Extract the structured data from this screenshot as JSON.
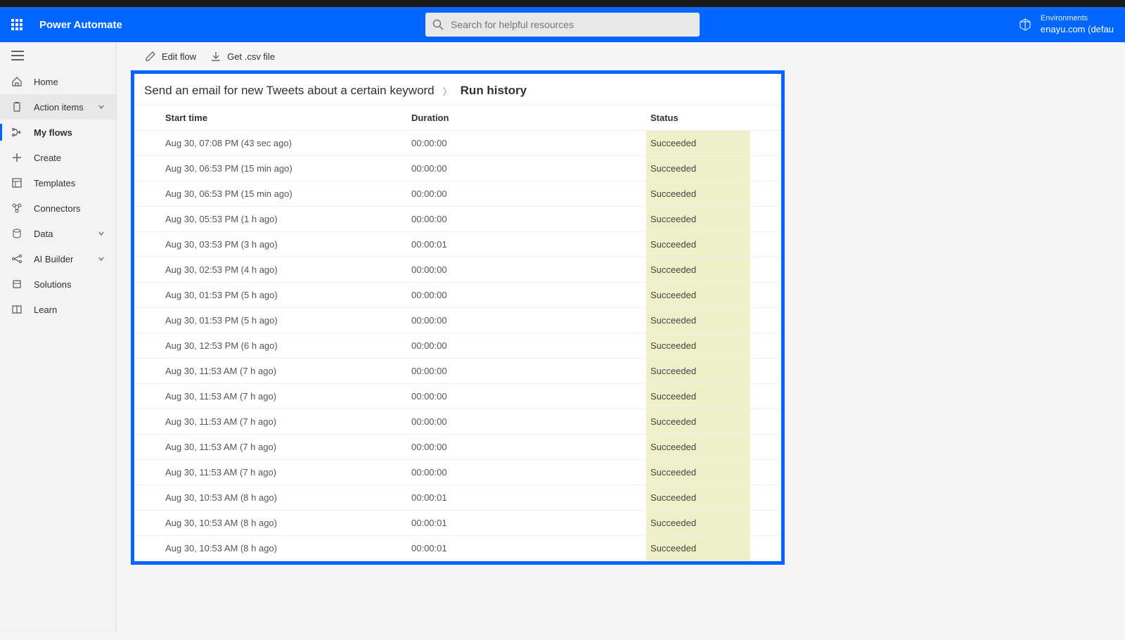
{
  "header": {
    "brand": "Power Automate",
    "search_placeholder": "Search for helpful resources",
    "env_label": "Environments",
    "env_value": "enayu.com (defau"
  },
  "sidebar": {
    "items": [
      {
        "id": "home",
        "label": "Home"
      },
      {
        "id": "action-items",
        "label": "Action items",
        "hovered": true,
        "has_chevron": true
      },
      {
        "id": "my-flows",
        "label": "My flows",
        "active": true
      },
      {
        "id": "create",
        "label": "Create"
      },
      {
        "id": "templates",
        "label": "Templates"
      },
      {
        "id": "connectors",
        "label": "Connectors"
      },
      {
        "id": "data",
        "label": "Data",
        "has_chevron": true
      },
      {
        "id": "ai-builder",
        "label": "AI Builder",
        "has_chevron": true
      },
      {
        "id": "solutions",
        "label": "Solutions"
      },
      {
        "id": "learn",
        "label": "Learn"
      }
    ]
  },
  "toolbar": {
    "edit_label": "Edit flow",
    "csv_label": "Get .csv file"
  },
  "breadcrumb": {
    "flow_name": "Send an email for new Tweets about a certain keyword",
    "current": "Run history"
  },
  "table": {
    "headers": {
      "start": "Start time",
      "duration": "Duration",
      "status": "Status"
    },
    "rows": [
      {
        "start": "Aug 30, 07:08 PM (43 sec ago)",
        "duration": "00:00:00",
        "status": "Succeeded"
      },
      {
        "start": "Aug 30, 06:53 PM (15 min ago)",
        "duration": "00:00:00",
        "status": "Succeeded"
      },
      {
        "start": "Aug 30, 06:53 PM (15 min ago)",
        "duration": "00:00:00",
        "status": "Succeeded"
      },
      {
        "start": "Aug 30, 05:53 PM (1 h ago)",
        "duration": "00:00:00",
        "status": "Succeeded"
      },
      {
        "start": "Aug 30, 03:53 PM (3 h ago)",
        "duration": "00:00:01",
        "status": "Succeeded"
      },
      {
        "start": "Aug 30, 02:53 PM (4 h ago)",
        "duration": "00:00:00",
        "status": "Succeeded"
      },
      {
        "start": "Aug 30, 01:53 PM (5 h ago)",
        "duration": "00:00:00",
        "status": "Succeeded"
      },
      {
        "start": "Aug 30, 01:53 PM (5 h ago)",
        "duration": "00:00:00",
        "status": "Succeeded"
      },
      {
        "start": "Aug 30, 12:53 PM (6 h ago)",
        "duration": "00:00:00",
        "status": "Succeeded"
      },
      {
        "start": "Aug 30, 11:53 AM (7 h ago)",
        "duration": "00:00:00",
        "status": "Succeeded"
      },
      {
        "start": "Aug 30, 11:53 AM (7 h ago)",
        "duration": "00:00:00",
        "status": "Succeeded"
      },
      {
        "start": "Aug 30, 11:53 AM (7 h ago)",
        "duration": "00:00:00",
        "status": "Succeeded"
      },
      {
        "start": "Aug 30, 11:53 AM (7 h ago)",
        "duration": "00:00:00",
        "status": "Succeeded"
      },
      {
        "start": "Aug 30, 11:53 AM (7 h ago)",
        "duration": "00:00:00",
        "status": "Succeeded"
      },
      {
        "start": "Aug 30, 10:53 AM (8 h ago)",
        "duration": "00:00:01",
        "status": "Succeeded"
      },
      {
        "start": "Aug 30, 10:53 AM (8 h ago)",
        "duration": "00:00:01",
        "status": "Succeeded"
      },
      {
        "start": "Aug 30, 10:53 AM (8 h ago)",
        "duration": "00:00:01",
        "status": "Succeeded"
      }
    ]
  }
}
